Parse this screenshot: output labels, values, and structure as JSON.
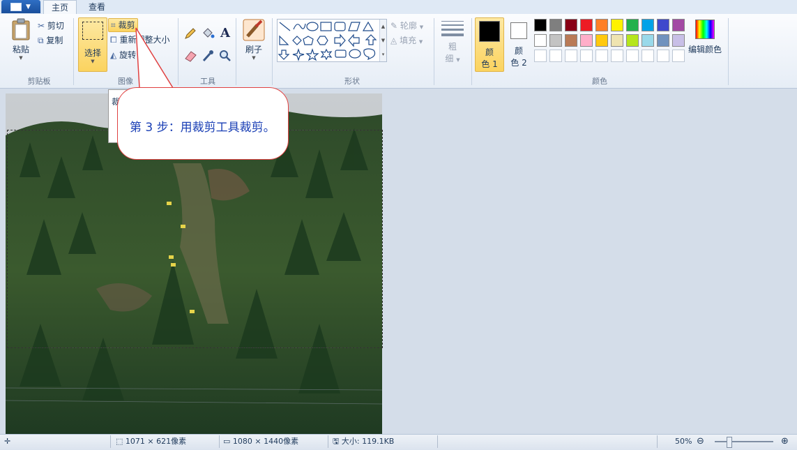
{
  "tabs": {
    "home": "主页",
    "view": "查看"
  },
  "clipboard": {
    "paste": "粘贴",
    "cut": "剪切",
    "copy": "复制",
    "label": "剪贴板"
  },
  "image": {
    "select": "选择",
    "crop": "裁剪",
    "resize": "重新调整大小",
    "rotate": "旋转",
    "label": "图像"
  },
  "tools": {
    "label": "工具",
    "text_glyph": "A"
  },
  "brushes": {
    "label": "刷子"
  },
  "shapes": {
    "outline": "轮廓",
    "fill": "填充",
    "label": "形状"
  },
  "size": {
    "label_top": "粗",
    "label_bottom": "细"
  },
  "colors": {
    "color1_top": "颜",
    "color1_bottom": "色 1",
    "color2_top": "颜",
    "color2_bottom": "色 2",
    "edit": "编辑颜色",
    "label": "颜色",
    "row1": [
      "#000000",
      "#7f7f7f",
      "#880015",
      "#ed1c24",
      "#ff7f27",
      "#fff200",
      "#22b14c",
      "#00a2e8",
      "#3f48cc",
      "#a349a4"
    ],
    "row2": [
      "#ffffff",
      "#c3c3c3",
      "#b97a57",
      "#ffaec9",
      "#ffc90e",
      "#efe4b0",
      "#b5e61d",
      "#99d9ea",
      "#7092be",
      "#c8bfe7"
    ],
    "row3": [
      "#ffffff",
      "#ffffff",
      "#ffffff",
      "#ffffff",
      "#ffffff",
      "#ffffff",
      "#ffffff",
      "#ffffff",
      "#ffffff",
      "#ffffff"
    ],
    "primary": "#000000",
    "secondary": "#ffffff"
  },
  "tooltip": {
    "partial": "裁"
  },
  "callout": {
    "text": "第 3 步：用裁剪工具裁剪。"
  },
  "status": {
    "selection_size": "1071 × 621像素",
    "image_size": "1080 × 1440像素",
    "file_size": "大小: 119.1KB",
    "zoom": "50%"
  }
}
